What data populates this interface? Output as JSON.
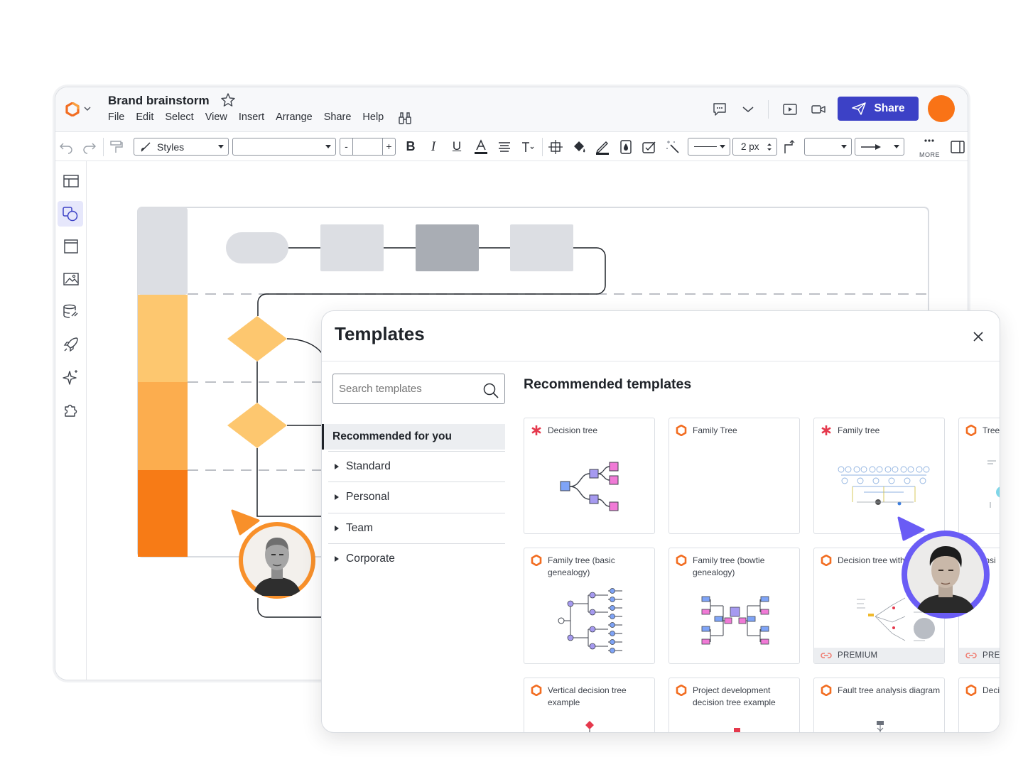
{
  "app": {
    "document_title": "Brand brainstorm",
    "menu": [
      "File",
      "Edit",
      "Select",
      "View",
      "Insert",
      "Arrange",
      "Share",
      "Help"
    ],
    "share_label": "Share",
    "brand_color": "#3c41c6",
    "user_avatar_color": "#f97316"
  },
  "toolbar": {
    "styles_label": "Styles",
    "font_value": "",
    "font_size_value": "",
    "stroke_width": "2 px",
    "more_label": "MORE"
  },
  "sidebar_icons": [
    "templates-icon",
    "shapes-icon",
    "page-icon",
    "image-icon",
    "data-icon",
    "rocket-icon",
    "sparkle-icon",
    "puzzle-icon"
  ],
  "templates_modal": {
    "title": "Templates",
    "search_placeholder": "Search templates",
    "active_category": "Recommended for you",
    "categories": [
      "Standard",
      "Personal",
      "Team",
      "Corporate"
    ],
    "section_title": "Recommended templates",
    "cards": [
      {
        "title": "Decision tree",
        "source": "asterisk",
        "premium": false
      },
      {
        "title": "Family Tree",
        "source": "lucid",
        "premium": false
      },
      {
        "title": "Family tree",
        "source": "asterisk",
        "premium": false
      },
      {
        "title": "Tree",
        "source": "lucid",
        "premium": false
      },
      {
        "title": "Family tree (basic genealogy)",
        "source": "lucid",
        "premium": false
      },
      {
        "title": "Family tree (bowtie genealogy)",
        "source": "lucid",
        "premium": false
      },
      {
        "title": "Decision tree with example",
        "source": "lucid",
        "premium": true
      },
      {
        "title": "Insi",
        "source": "lucid",
        "premium": true
      },
      {
        "title": "Vertical decision tree example",
        "source": "lucid",
        "premium": false
      },
      {
        "title": "Project development decision tree example",
        "source": "lucid",
        "premium": false
      },
      {
        "title": "Fault tree analysis diagram",
        "source": "lucid",
        "premium": false
      },
      {
        "title": "Deci form",
        "source": "lucid",
        "premium": false
      }
    ],
    "premium_label": "PREMIUM",
    "premium_label_cut": "PREM"
  }
}
